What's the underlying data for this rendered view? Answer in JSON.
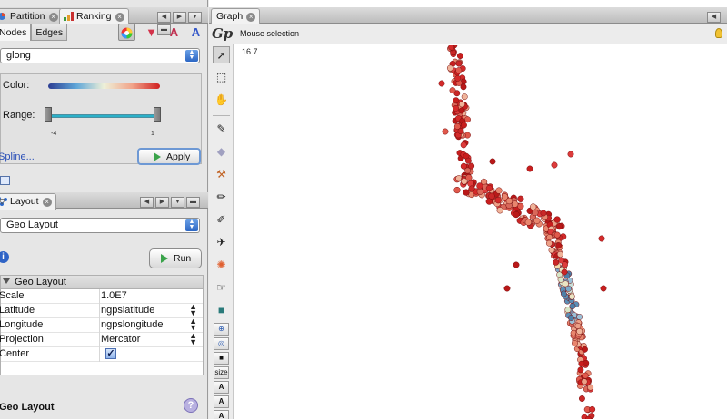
{
  "left_tabs": {
    "partition": "Partition",
    "ranking": "Ranking"
  },
  "ranking": {
    "subtabs": [
      "Nodes",
      "Edges"
    ],
    "attribute": "glong",
    "color_label": "Color:",
    "range_label": "Range:",
    "range_min": "-4",
    "range_max": "1",
    "range_selection": [
      0.0,
      1.0
    ],
    "spline_link": "Spline...",
    "apply": "Apply",
    "gradient_colors": [
      "#2c3e93",
      "#5fa6d8",
      "#eef0d8",
      "#f1a48a",
      "#d02020"
    ]
  },
  "layout_tab": {
    "title": "Layout"
  },
  "layout": {
    "algorithm": "Geo Layout",
    "run": "Run",
    "group": "Geo Layout",
    "properties": [
      {
        "key": "Scale",
        "value": "1.0E7",
        "kind": "text"
      },
      {
        "key": "Latitude",
        "value": "ngpslatitude",
        "kind": "select"
      },
      {
        "key": "Longitude",
        "value": "ngpslongitude",
        "kind": "select"
      },
      {
        "key": "Projection",
        "value": "Mercator",
        "kind": "select"
      },
      {
        "key": "Center",
        "value": true,
        "kind": "checkbox"
      }
    ],
    "description_title": "Geo Layout"
  },
  "graph": {
    "tab": "Graph",
    "mode": "Mouse selection",
    "zoom": "16.7",
    "size_label": "size"
  }
}
